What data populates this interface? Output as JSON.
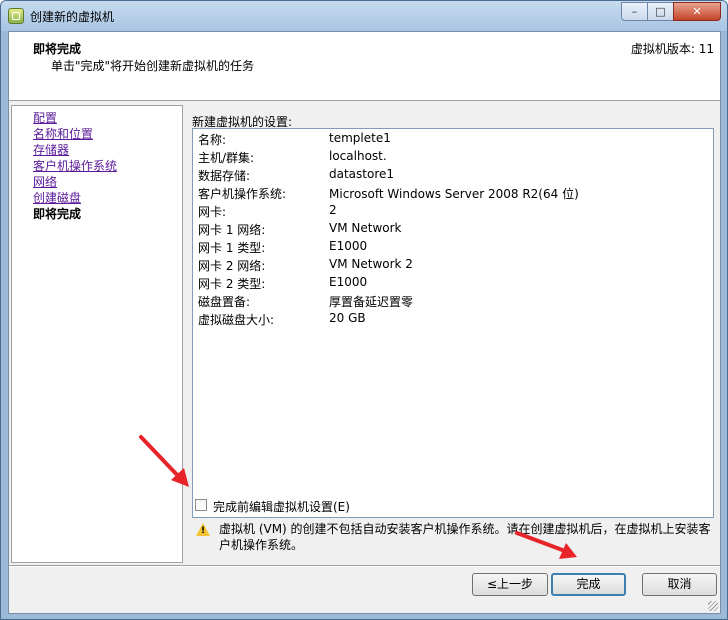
{
  "window": {
    "title": "创建新的虚拟机",
    "controls": {
      "minimize": "–",
      "maximize": "□",
      "close": "✕"
    }
  },
  "header": {
    "title": "即将完成",
    "subtitle": "单击\"完成\"将开始创建新虚拟机的任务",
    "version": "虚拟机版本: 11"
  },
  "nav": {
    "items": [
      {
        "label": "配置"
      },
      {
        "label": "名称和位置"
      },
      {
        "label": "存储器"
      },
      {
        "label": "客户机操作系统"
      },
      {
        "label": "网络"
      },
      {
        "label": "创建磁盘"
      },
      {
        "label": "即将完成"
      }
    ],
    "current_index": 6
  },
  "summary": {
    "label": "新建虚拟机的设置:",
    "rows": [
      {
        "key": "名称:",
        "value": "templete1"
      },
      {
        "key": "主机/群集:",
        "value": "localhost."
      },
      {
        "key": "数据存储:",
        "value": "datastore1"
      },
      {
        "key": "客户机操作系统:",
        "value": "Microsoft Windows Server 2008 R2(64 位)"
      },
      {
        "key": "网卡:",
        "value": "2"
      },
      {
        "key": "网卡 1 网络:",
        "value": "VM Network"
      },
      {
        "key": "网卡 1 类型:",
        "value": "E1000"
      },
      {
        "key": "网卡 2 网络:",
        "value": "VM Network 2"
      },
      {
        "key": "网卡 2 类型:",
        "value": "E1000"
      },
      {
        "key": "磁盘置备:",
        "value": "厚置备延迟置零"
      },
      {
        "key": "虚拟磁盘大小:",
        "value": "20 GB"
      }
    ]
  },
  "edit_checkbox": {
    "label": "完成前编辑虚拟机设置(E)",
    "checked": false
  },
  "warning": {
    "icon": "warning-icon",
    "icon_mark": "!",
    "text": "虚拟机 (VM) 的创建不包括自动安装客户机操作系统。请在创建虚拟机后，在虚拟机上安装客户机操作系统。"
  },
  "buttons": {
    "back": "≤上一步",
    "finish": "完成",
    "cancel": "取消"
  },
  "annotation_color": "#e8232a"
}
